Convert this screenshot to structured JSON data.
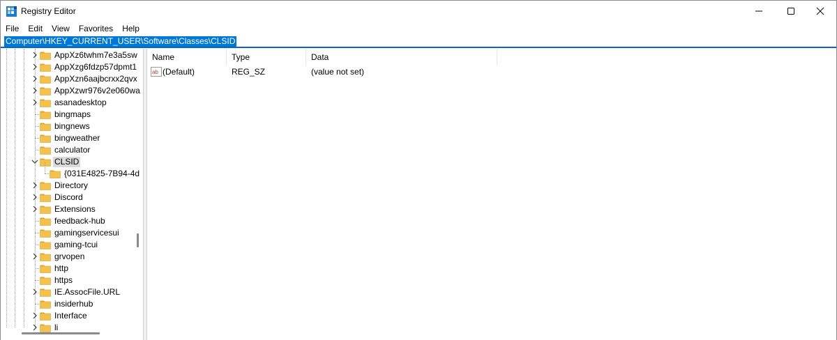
{
  "window": {
    "title": "Registry Editor",
    "controls": {
      "minimize": "minimize",
      "maximize": "maximize",
      "close": "close"
    }
  },
  "menu": [
    "File",
    "Edit",
    "View",
    "Favorites",
    "Help"
  ],
  "address": "Computer\\HKEY_CURRENT_USER\\Software\\Classes\\CLSID",
  "tree": [
    {
      "label": "AppXz6twhm7e3a5sw",
      "expander": "collapsed",
      "depth": 0
    },
    {
      "label": "AppXzg6fdzp57dpmt1",
      "expander": "collapsed",
      "depth": 0
    },
    {
      "label": "AppXzn6aajbcrxx2qvx",
      "expander": "collapsed",
      "depth": 0
    },
    {
      "label": "AppXzwr976v2e060wa",
      "expander": "collapsed",
      "depth": 0
    },
    {
      "label": "asanadesktop",
      "expander": "collapsed",
      "depth": 0
    },
    {
      "label": "bingmaps",
      "expander": "none",
      "depth": 0
    },
    {
      "label": "bingnews",
      "expander": "none",
      "depth": 0
    },
    {
      "label": "bingweather",
      "expander": "none",
      "depth": 0
    },
    {
      "label": "calculator",
      "expander": "none",
      "depth": 0
    },
    {
      "label": "CLSID",
      "expander": "expanded",
      "depth": 0,
      "selected": true
    },
    {
      "label": "{031E4825-7B94-4d",
      "expander": "none",
      "depth": 1
    },
    {
      "label": "Directory",
      "expander": "collapsed",
      "depth": 0
    },
    {
      "label": "Discord",
      "expander": "collapsed",
      "depth": 0
    },
    {
      "label": "Extensions",
      "expander": "collapsed",
      "depth": 0
    },
    {
      "label": "feedback-hub",
      "expander": "none",
      "depth": 0
    },
    {
      "label": "gamingservicesui",
      "expander": "none",
      "depth": 0
    },
    {
      "label": "gaming-tcui",
      "expander": "none",
      "depth": 0
    },
    {
      "label": "grvopen",
      "expander": "collapsed",
      "depth": 0
    },
    {
      "label": "http",
      "expander": "none",
      "depth": 0
    },
    {
      "label": "https",
      "expander": "none",
      "depth": 0
    },
    {
      "label": "IE.AssocFile.URL",
      "expander": "collapsed",
      "depth": 0
    },
    {
      "label": "insiderhub",
      "expander": "none",
      "depth": 0
    },
    {
      "label": "Interface",
      "expander": "collapsed",
      "depth": 0
    },
    {
      "label": "li",
      "expander": "collapsed",
      "depth": 0
    }
  ],
  "list": {
    "columns": {
      "name": "Name",
      "type": "Type",
      "data": "Data"
    },
    "rows": [
      {
        "name": "(Default)",
        "type": "REG_SZ",
        "data": "(value not set)",
        "icon": "string-value-icon"
      }
    ]
  },
  "colors": {
    "selection": "#0078d7",
    "folder": "#f3c24d",
    "folder_dark": "#d9a42b"
  }
}
